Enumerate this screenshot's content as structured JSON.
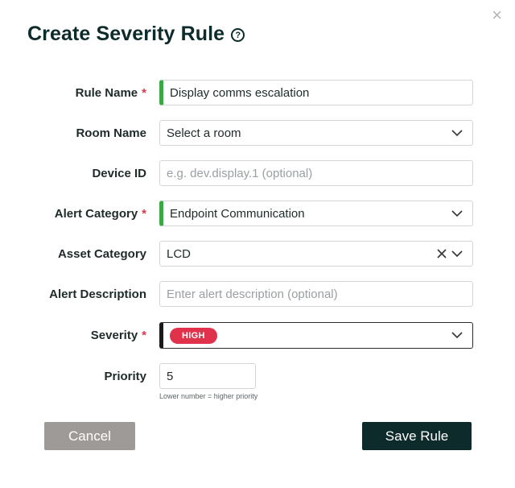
{
  "dialog": {
    "title": "Create Severity Rule",
    "help_icon": "question-circle-icon",
    "close_icon": "×"
  },
  "form": {
    "rule_name": {
      "label": "Rule Name",
      "required_mark": "*",
      "value": "Display comms escalation"
    },
    "room_name": {
      "label": "Room Name",
      "value": "Select a room"
    },
    "device_id": {
      "label": "Device ID",
      "placeholder": "e.g. dev.display.1 (optional)"
    },
    "alert_category": {
      "label": "Alert Category",
      "required_mark": "*",
      "value": "Endpoint Communication"
    },
    "asset_category": {
      "label": "Asset Category",
      "value": "LCD"
    },
    "alert_description": {
      "label": "Alert Description",
      "placeholder": "Enter alert description (optional)"
    },
    "severity": {
      "label": "Severity",
      "required_mark": "*",
      "value": "HIGH",
      "badge_color": "#e0324b"
    },
    "priority": {
      "label": "Priority",
      "value": "5",
      "hint": "Lower number = higher priority"
    }
  },
  "buttons": {
    "cancel": "Cancel",
    "save": "Save Rule"
  },
  "colors": {
    "primary": "#0e2b2b",
    "required_bar": "#3aa845",
    "required_mark": "#d9374b",
    "cancel_bg": "#9e9a97"
  }
}
